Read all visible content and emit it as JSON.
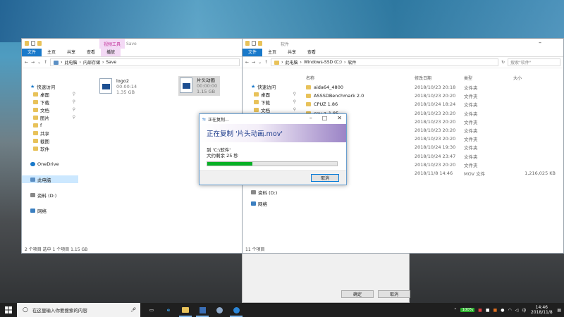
{
  "left_window": {
    "context_tab": "视频工具",
    "title": "Save",
    "ribbon_tabs": [
      "文件",
      "主页",
      "共享",
      "查看",
      "播放"
    ],
    "breadcrumb": [
      "此电脑",
      "内部存储",
      "Save"
    ],
    "nav": [
      {
        "label": "快速访问",
        "icon": "star",
        "pin": false
      },
      {
        "label": "桌面",
        "icon": "folder",
        "pin": true,
        "sub": true
      },
      {
        "label": "下载",
        "icon": "folder",
        "pin": true,
        "sub": true
      },
      {
        "label": "文档",
        "icon": "folder",
        "pin": true,
        "sub": true
      },
      {
        "label": "图片",
        "icon": "folder",
        "pin": true,
        "sub": true
      },
      {
        "label": "f",
        "icon": "folder",
        "pin": false,
        "sub": true
      },
      {
        "label": "共享",
        "icon": "folder",
        "pin": false,
        "sub": true
      },
      {
        "label": "截图",
        "icon": "folder",
        "pin": false,
        "sub": true
      },
      {
        "label": "软件",
        "icon": "folder",
        "pin": false,
        "sub": true
      },
      {
        "label": "",
        "icon": "",
        "pin": false
      },
      {
        "label": "OneDrive",
        "icon": "cloud",
        "pin": false
      },
      {
        "label": "",
        "icon": "",
        "pin": false
      },
      {
        "label": "此电脑",
        "icon": "pc",
        "pin": false,
        "selected": true
      },
      {
        "label": "",
        "icon": "",
        "pin": false
      },
      {
        "label": "资料 (D:)",
        "icon": "drive",
        "pin": false
      },
      {
        "label": "",
        "icon": "",
        "pin": false
      },
      {
        "label": "网络",
        "icon": "net",
        "pin": false
      }
    ],
    "files": [
      {
        "name": "logo2",
        "duration": "00:00:14",
        "size": "1.35 GB"
      },
      {
        "name": "片头动画",
        "duration": "00:00:00",
        "size": "1.15 GB"
      }
    ],
    "status": "2 个项目    选中 1 个项目  1.15 GB"
  },
  "right_window": {
    "title": "软件",
    "ribbon_tabs": [
      "文件",
      "主页",
      "共享",
      "查看"
    ],
    "breadcrumb": [
      "此电脑",
      "Windows-SSD (C:)",
      "软件"
    ],
    "search_placeholder": "搜索\"软件\"",
    "columns": {
      "name": "名称",
      "date": "修改日期",
      "type": "类型",
      "size": "大小"
    },
    "nav": [
      {
        "label": "快速访问",
        "icon": "star"
      },
      {
        "label": "桌面",
        "icon": "folder",
        "pin": true
      },
      {
        "label": "下载",
        "icon": "folder",
        "pin": true
      },
      {
        "label": "文档",
        "icon": "folder",
        "pin": true
      },
      {
        "label": "资料 (D:)",
        "icon": "drive"
      },
      {
        "label": "网络",
        "icon": "net"
      }
    ],
    "rows": [
      {
        "name": "aida64_4800",
        "date": "2018/10/23 20:18",
        "type": "文件夹",
        "size": ""
      },
      {
        "name": "ASSSDBenchmark 2.0",
        "date": "2018/10/23 20:20",
        "type": "文件夹",
        "size": ""
      },
      {
        "name": "CPUZ 1.86",
        "date": "2018/10/24 18:24",
        "type": "文件夹",
        "size": ""
      },
      {
        "name": "cpu-z_1.85",
        "date": "2018/10/23 20:20",
        "type": "文件夹",
        "size": ""
      },
      {
        "name": "",
        "date": "2018/10/23 20:20",
        "type": "文件夹",
        "size": ""
      },
      {
        "name": "",
        "date": "2018/10/23 20:20",
        "type": "文件夹",
        "size": ""
      },
      {
        "name": "",
        "date": "2018/10/23 20:20",
        "type": "文件夹",
        "size": ""
      },
      {
        "name": "",
        "date": "2018/10/24 19:30",
        "type": "文件夹",
        "size": ""
      },
      {
        "name": "",
        "date": "2018/10/24 23:47",
        "type": "文件夹",
        "size": ""
      },
      {
        "name": "",
        "date": "2018/10/23 20:20",
        "type": "文件夹",
        "size": ""
      },
      {
        "name": "",
        "date": "2018/11/8 14:46",
        "type": "MOV 文件",
        "size": "1,216,025 KB"
      }
    ],
    "status": "11 个项目"
  },
  "dialog": {
    "title": "正在复制...",
    "heading": "正在复制 '片头动画.mov'",
    "to": "到 'C:\\软件'",
    "remaining": "大约剩余 25 秒",
    "progress": 0.35,
    "cancel": "取消"
  },
  "bottom_panel": {
    "ok": "确定",
    "cancel": "取消"
  },
  "taskbar": {
    "search_placeholder": "在这里输入你要搜索的内容",
    "battery": "100%",
    "ime": "中",
    "time": "14:46",
    "date": "2018/11/8"
  }
}
